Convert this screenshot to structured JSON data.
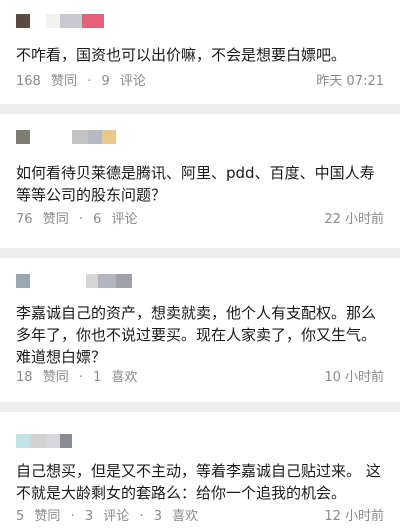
{
  "comments": [
    {
      "text": "不咋看，国资也可以出价嘛，不会是想要白嫖吧。",
      "likes": "168",
      "like_label": "赞同",
      "dot": "·",
      "second_count": "9",
      "second_label": "评论",
      "time": "昨天 07:21",
      "avatar_colors": [
        "#5a4a3f",
        "#f2f2f2",
        "#c9c9cf",
        "#e85f7a"
      ]
    },
    {
      "text": "如何看待贝莱德是腾讯、阿里、pdd、百度、中国人寿等等公司的股东问题？",
      "likes": "76",
      "like_label": "赞同",
      "dot": "·",
      "second_count": "6",
      "second_label": "评论",
      "time": "22 小时前",
      "avatar_colors": [
        "#7d7d72",
        "#c4c4c4",
        "#b7b8c2",
        "#e9c98a"
      ]
    },
    {
      "text": "李嘉诚自己的资产，想卖就卖，他个人有支配权。那么多年了，你也不说过要买。现在人家卖了，你又生气。难道想白嫖？",
      "likes": "18",
      "like_label": "赞同",
      "dot": "·",
      "second_count": "1",
      "second_label": "喜欢",
      "time": "10 小时前",
      "avatar_colors": [
        "#9aa7b3",
        "#d6d6d6",
        "#b4b4be",
        "#a0a0a8"
      ]
    },
    {
      "text": "自己想买，但是又不主动，等着李嘉诚自己贴过来。 这不就是大龄剩女的套路么：给你一个追我的机会。",
      "likes": "5",
      "like_label": "赞同",
      "dot": "·",
      "second_count": "3",
      "second_label": "评论",
      "third_count": "3",
      "third_label": "喜欢",
      "time": "12 小时前",
      "avatar_colors": [
        "#bfe3e6",
        "#d2d2d2",
        "#d6d6dc",
        "#8a8a92"
      ]
    }
  ]
}
